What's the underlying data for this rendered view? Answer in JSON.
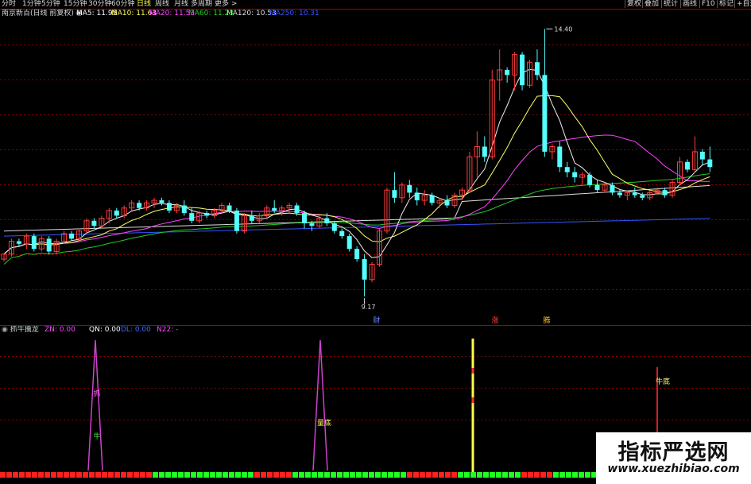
{
  "colors": {
    "up": "#ff3b3b",
    "down": "#54ffff",
    "ma5": "#f0f0f0",
    "ma10": "#ffff66",
    "ma20": "#ff44ff",
    "ma60": "#22cc22",
    "ma120": "#dddddd",
    "ma250": "#3355ff",
    "grid": "#880000",
    "signal": "#ffff44"
  },
  "toolbar": {
    "periods": [
      "分时",
      "1分钟",
      "5分钟",
      "15分钟",
      "30分钟",
      "60分钟",
      "日线",
      "周线",
      "月线",
      "多周期",
      "更多 >"
    ],
    "active_period": "日线",
    "right_buttons": [
      "复权",
      "叠加",
      "统计",
      "画线",
      "F10",
      "标记",
      "+自选"
    ]
  },
  "main_panel": {
    "title": "南京新百(日线 前复权)",
    "ma": [
      {
        "label": "MA5: 11.95",
        "color": "#ffffff"
      },
      {
        "label": "MA10: 11.63",
        "color": "#ffff66"
      },
      {
        "label": "MA20: 11.53",
        "color": "#ff44ff"
      },
      {
        "label": "MA60: 11.23",
        "color": "#22cc22"
      },
      {
        "label": "MA120: 10.53",
        "color": "#dddddd"
      },
      {
        "label": "MA250: 10.31",
        "color": "#3355ff"
      }
    ],
    "high_label": "14.40",
    "low_label": "9.17",
    "markers": [
      {
        "text": "财",
        "color": "#6688ff"
      },
      {
        "text": "涨",
        "color": "#ff4444"
      },
      {
        "text": "腾",
        "color": "#ffcc33"
      }
    ]
  },
  "sub_panel": {
    "title": "抓牛擒龙",
    "values": [
      {
        "label": "ZN: 0.00",
        "color": "#ff44ff"
      },
      {
        "label": "QN: 0.00",
        "color": "#ffffff"
      },
      {
        "label": "DL: 0.00",
        "color": "#4466ff"
      },
      {
        "label": "N22: -",
        "color": "#ff44ff"
      }
    ],
    "annotations": [
      {
        "text": "抓",
        "color": "#ff66ff"
      },
      {
        "text": "牛",
        "color": "#44ff44"
      },
      {
        "text": "量底",
        "color": "#ffff66"
      },
      {
        "text": "牛底",
        "color": "#ffff66"
      }
    ]
  },
  "watermark": {
    "title": "指标严选网",
    "url": "www.xuezhibiao.com"
  },
  "chart_data": {
    "type": "candlestick",
    "title": "南京新百(日线 前复权)",
    "ylim": [
      9.0,
      14.5
    ],
    "candles": [
      [
        9.9,
        10.0,
        9.85,
        10.0
      ],
      [
        10.0,
        10.3,
        9.95,
        10.25
      ],
      [
        10.25,
        10.3,
        10.15,
        10.2
      ],
      [
        10.2,
        10.4,
        10.1,
        10.35
      ],
      [
        10.35,
        10.4,
        10.05,
        10.1
      ],
      [
        10.1,
        10.35,
        10.05,
        10.3
      ],
      [
        10.3,
        10.35,
        10.0,
        10.05
      ],
      [
        10.05,
        10.3,
        10.0,
        10.25
      ],
      [
        10.25,
        10.45,
        10.2,
        10.4
      ],
      [
        10.4,
        10.45,
        10.25,
        10.3
      ],
      [
        10.3,
        10.5,
        10.25,
        10.45
      ],
      [
        10.45,
        10.7,
        10.4,
        10.65
      ],
      [
        10.65,
        10.7,
        10.5,
        10.55
      ],
      [
        10.55,
        10.75,
        10.5,
        10.7
      ],
      [
        10.7,
        10.9,
        10.6,
        10.85
      ],
      [
        10.85,
        10.9,
        10.7,
        10.75
      ],
      [
        10.75,
        10.95,
        10.7,
        10.9
      ],
      [
        10.9,
        11.05,
        10.85,
        11.0
      ],
      [
        11.0,
        11.05,
        10.85,
        10.9
      ],
      [
        10.9,
        11.05,
        10.85,
        11.0
      ],
      [
        11.0,
        11.1,
        10.9,
        11.05
      ],
      [
        11.05,
        11.1,
        10.95,
        11.0
      ],
      [
        11.0,
        11.05,
        10.8,
        10.85
      ],
      [
        10.85,
        11.0,
        10.8,
        10.95
      ],
      [
        10.95,
        11.05,
        10.75,
        10.8
      ],
      [
        10.8,
        10.9,
        10.6,
        10.65
      ],
      [
        10.65,
        10.85,
        10.6,
        10.8
      ],
      [
        10.8,
        10.85,
        10.7,
        10.75
      ],
      [
        10.75,
        10.9,
        10.7,
        10.85
      ],
      [
        10.85,
        11.0,
        10.8,
        10.95
      ],
      [
        10.95,
        11.0,
        10.8,
        10.85
      ],
      [
        10.85,
        10.9,
        10.4,
        10.45
      ],
      [
        10.45,
        10.8,
        10.4,
        10.75
      ],
      [
        10.75,
        10.85,
        10.6,
        10.65
      ],
      [
        10.65,
        10.8,
        10.6,
        10.75
      ],
      [
        10.75,
        10.95,
        10.7,
        10.9
      ],
      [
        10.9,
        11.05,
        10.8,
        10.85
      ],
      [
        10.85,
        10.95,
        10.75,
        10.9
      ],
      [
        10.9,
        11.0,
        10.8,
        10.95
      ],
      [
        10.95,
        11.0,
        10.75,
        10.8
      ],
      [
        10.8,
        10.85,
        10.5,
        10.6
      ],
      [
        10.6,
        10.65,
        10.45,
        10.55
      ],
      [
        10.55,
        10.75,
        10.5,
        10.7
      ],
      [
        10.7,
        10.8,
        10.55,
        10.6
      ],
      [
        10.6,
        10.65,
        10.4,
        10.45
      ],
      [
        10.45,
        10.5,
        10.3,
        10.35
      ],
      [
        10.35,
        10.4,
        10.05,
        10.1
      ],
      [
        10.1,
        10.15,
        9.85,
        9.9
      ],
      [
        9.9,
        10.0,
        9.17,
        9.5
      ],
      [
        9.5,
        9.85,
        9.45,
        9.8
      ],
      [
        9.8,
        10.5,
        9.75,
        10.45
      ],
      [
        10.45,
        11.3,
        10.4,
        11.25
      ],
      [
        11.25,
        11.6,
        11.0,
        11.1
      ],
      [
        11.1,
        11.4,
        11.0,
        11.35
      ],
      [
        11.35,
        11.45,
        11.1,
        11.2
      ],
      [
        11.2,
        11.3,
        10.95,
        11.05
      ],
      [
        11.05,
        11.25,
        10.95,
        11.15
      ],
      [
        11.15,
        11.2,
        10.95,
        11.0
      ],
      [
        11.0,
        11.1,
        10.9,
        11.05
      ],
      [
        11.05,
        11.15,
        10.9,
        10.95
      ],
      [
        10.95,
        11.2,
        10.9,
        11.15
      ],
      [
        11.15,
        11.3,
        11.05,
        11.25
      ],
      [
        11.25,
        12.0,
        11.2,
        11.9
      ],
      [
        11.9,
        12.4,
        11.5,
        12.1
      ],
      [
        12.1,
        12.3,
        11.8,
        11.9
      ],
      [
        11.9,
        13.6,
        11.85,
        13.4
      ],
      [
        13.4,
        14.0,
        13.0,
        13.6
      ],
      [
        13.6,
        13.65,
        13.35,
        13.5
      ],
      [
        13.5,
        13.95,
        13.2,
        13.9
      ],
      [
        13.9,
        13.95,
        13.2,
        13.3
      ],
      [
        13.3,
        13.8,
        13.25,
        13.75
      ],
      [
        13.75,
        14.0,
        13.4,
        13.5
      ],
      [
        13.5,
        14.4,
        11.9,
        12.0
      ],
      [
        12.0,
        12.15,
        11.85,
        12.1
      ],
      [
        12.1,
        12.2,
        11.6,
        11.7
      ],
      [
        11.7,
        11.8,
        11.5,
        11.6
      ],
      [
        11.6,
        11.7,
        11.4,
        11.5
      ],
      [
        11.5,
        11.6,
        11.35,
        11.55
      ],
      [
        11.55,
        11.6,
        11.3,
        11.35
      ],
      [
        11.35,
        11.45,
        11.2,
        11.25
      ],
      [
        11.25,
        11.4,
        11.2,
        11.35
      ],
      [
        11.35,
        11.4,
        11.15,
        11.2
      ],
      [
        11.2,
        11.25,
        11.1,
        11.15
      ],
      [
        11.15,
        11.25,
        11.05,
        11.2
      ],
      [
        11.2,
        11.3,
        11.1,
        11.15
      ],
      [
        11.15,
        11.2,
        11.05,
        11.1
      ],
      [
        11.1,
        11.25,
        11.05,
        11.2
      ],
      [
        11.2,
        11.3,
        11.15,
        11.25
      ],
      [
        11.25,
        11.3,
        11.1,
        11.15
      ],
      [
        11.15,
        11.45,
        11.1,
        11.4
      ],
      [
        11.4,
        11.9,
        11.35,
        11.8
      ],
      [
        11.8,
        11.85,
        11.6,
        11.65
      ],
      [
        11.65,
        12.3,
        11.6,
        12.0
      ],
      [
        12.0,
        12.05,
        11.75,
        11.85
      ],
      [
        11.85,
        12.1,
        11.6,
        11.7
      ]
    ],
    "sub_signals": {
      "spikes_at": [
        17,
        57
      ],
      "yellow_line_at": 81,
      "red_line_at": 116
    }
  }
}
